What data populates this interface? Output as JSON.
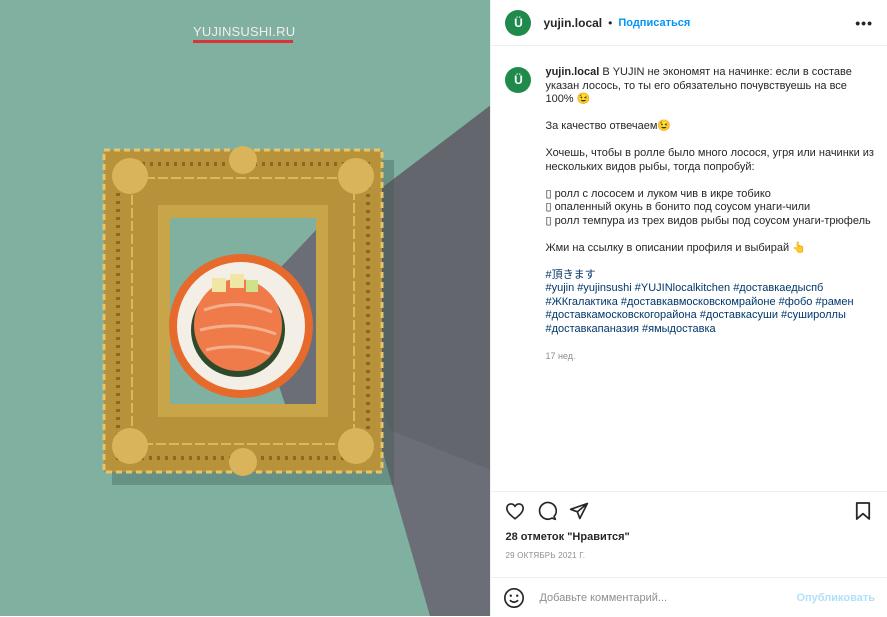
{
  "image": {
    "watermark": "YUJINSUSHI.RU",
    "colors": {
      "teal": "#7fb0a0",
      "grey": "#6b6e76",
      "frame": "#b8923a",
      "salmon": "#ef7a4a",
      "rice": "#f4efe6"
    }
  },
  "header": {
    "avatar_letter": "Ü",
    "username": "yujin.local",
    "separator": "•",
    "follow_label": "Подписаться",
    "more_label": "•••"
  },
  "caption": {
    "avatar_letter": "Ü",
    "username": "yujin.local",
    "line1": "В YUJIN не экономят на начинке: если в составе указан лосось, то ты его обязательно почувствуешь на все 100% 😉",
    "line2": "За качество отвечаем😉",
    "line3": "Хочешь, чтобы в ролле было много лосося, угря или начинки из нескольких видов рыбы, тогда попробуй:",
    "item1": "▯ ролл с лососем и луком чив в икре тобико",
    "item2": "▯ опаленный окунь в бонито под соусом унаги-чили",
    "item3": "▯ ролл темпура из трех видов рыбы под соусом унаги-трюфель",
    "line4": "Жми на ссылку в описании профиля и выбирай 👆",
    "hashtags": [
      "#頂きます",
      "#yujin",
      "#yujinsushi",
      "#YUJINlocalkitchen",
      "#доставкаедыспб",
      "#ЖКгалактика",
      "#доставкавмосковскомрайоне",
      "#фобо",
      "#рамен",
      "#доставкамосковскогорайона",
      "#доставкасуши",
      "#сушироллы",
      "#доставкапаназия",
      "#ямыдоставка"
    ],
    "age": "17 нед."
  },
  "actions": {
    "likes": "28 отметок \"Нравится\"",
    "date": "29 ОКТЯБРЬ 2021 Г."
  },
  "comment": {
    "placeholder": "Добавьте комментарий...",
    "publish_label": "Опубликовать"
  }
}
